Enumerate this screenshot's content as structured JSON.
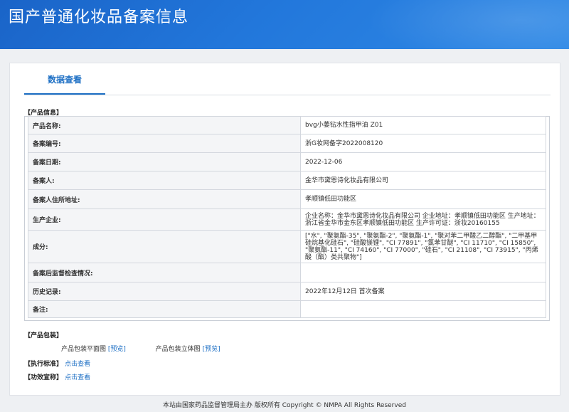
{
  "header": {
    "title": "国产普通化妆品备案信息"
  },
  "tab": {
    "label": "数据查看"
  },
  "product_info": {
    "section_label": "【产品信息】",
    "rows": [
      {
        "label": "产品名称:",
        "value": "bvg小萎钻水性指甲油 Z01"
      },
      {
        "label": "备案编号:",
        "value": "浙G妆网备字2022008120"
      },
      {
        "label": "备案日期:",
        "value": "2022-12-06"
      },
      {
        "label": "备案人:",
        "value": "金华市黛恩诗化妆品有限公司"
      },
      {
        "label": "备案人住所地址:",
        "value": "孝顺镇低田功能区"
      },
      {
        "label": "生产企业:",
        "value": "企业名称：金华市黛恩诗化妆品有限公司 企业地址：孝顺镇低田功能区 生产地址：浙江省金华市金东区孝顺镇低田功能区 生产许可证：浙妆20160155"
      },
      {
        "label": "成分:",
        "value": "[\"水\", \"聚氨酯-35\", \"聚氨酯-2\", \"聚氨酯-1\", \"聚对苯二甲酸乙二醇酯\", \"二甲基甲硅烷基化硅石\", \"硅酸镁锂\", \"CI 77891\", \"氯苯甘醚\", \"CI 11710\", \"CI 15850\", \"聚氨酯-11\", \"CI 74160\", \"CI 77000\", \"硅石\", \"CI 21108\", \"CI 73915\", \"丙烯酸（酯）类共聚物\"]"
      },
      {
        "label": "备案后监督检查情况:",
        "value": ""
      },
      {
        "label": "历史记录:",
        "value": "2022年12月12日 首次备案"
      },
      {
        "label": "备注:",
        "value": ""
      }
    ]
  },
  "packaging": {
    "section_label": "【产品包装】",
    "flat_label": "产品包装平面图",
    "flat_link": "[预览]",
    "solid_label": "产品包装立体图",
    "solid_link": "[预览]"
  },
  "standard": {
    "label": "【执行标准】",
    "link": "点击查看"
  },
  "efficacy": {
    "label": "【功效宣称】",
    "link": "点击查看"
  },
  "footer": {
    "text": "本站由国家药品监督管理局主办 版权所有 Copyright © NMPA All Rights Reserved"
  }
}
